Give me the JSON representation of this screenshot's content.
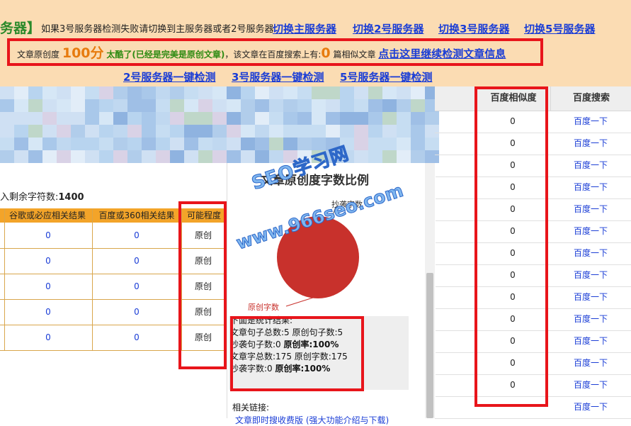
{
  "header": {
    "brand": "务器】",
    "hint": "如果3号服务器检测失败请切换到主服务器或者2号服务器",
    "links": [
      "切换主服务器",
      "切换2号服务器",
      "切换3号服务器",
      "切换5号服务器"
    ]
  },
  "originality": {
    "label": "文章原创度",
    "score": "100分",
    "verdict": "太酷了(已经是完美是原创文章)",
    "search_prefix": "，该文章在百度搜索上有:",
    "similar_count": "0",
    "similar_suffix": "篇相似文章",
    "continue_link": "点击这里继续检测文章信息"
  },
  "check_links": [
    "2号服务器一键检测",
    "3号服务器一键检测",
    "5号服务器一键检测"
  ],
  "right_table": {
    "headers": [
      "百度相似度",
      "百度搜索"
    ],
    "rows": [
      {
        "similarity": "0",
        "search": "百度一下"
      },
      {
        "similarity": "0",
        "search": "百度一下"
      },
      {
        "similarity": "0",
        "search": "百度一下"
      },
      {
        "similarity": "0",
        "search": "百度一下"
      },
      {
        "similarity": "0",
        "search": "百度一下"
      },
      {
        "similarity": "0",
        "search": "百度一下"
      },
      {
        "similarity": "0",
        "search": "百度一下"
      },
      {
        "similarity": "0",
        "search": "百度一下"
      },
      {
        "similarity": "0",
        "search": "百度一下"
      },
      {
        "similarity": "0",
        "search": "百度一下"
      },
      {
        "similarity": "0",
        "search": "百度一下"
      },
      {
        "similarity": "0",
        "search": "百度一下"
      },
      {
        "similarity": "0",
        "search": "百度一下"
      },
      {
        "similarity": "",
        "search": "百度一下"
      }
    ]
  },
  "left_table": {
    "remain_label": "入剩余字符数:",
    "remain_value": "1400",
    "headers": [
      "谷歌或必应相关结果",
      "百度或360相关结果",
      "可能程度"
    ],
    "rows": [
      {
        "google": "0",
        "baidu": "0",
        "level": "原创"
      },
      {
        "google": "0",
        "baidu": "0",
        "level": "原创"
      },
      {
        "google": "0",
        "baidu": "0",
        "level": "原创"
      },
      {
        "google": "0",
        "baidu": "0",
        "level": "原创"
      },
      {
        "google": "0",
        "baidu": "0",
        "level": "原创"
      }
    ]
  },
  "pie": {
    "title": "文章原创度字数比例",
    "label_copy": "抄袭字数",
    "label_orig": "原创字数",
    "color": "#c8312c"
  },
  "stats": {
    "intro": "下面是统计结果:",
    "line1": "文章句子总数:5 原创句子数:5",
    "line2_prefix": "抄袭句子数:0 ",
    "line2_bold": "原创率:100%",
    "line3": "文章字总数:175 原创字数:175",
    "line4_prefix": "抄袭字数:0 ",
    "line4_bold": "原创率:100%"
  },
  "related_label": "相关链接:",
  "related_link": "文章即时搜收费版 (强大功能介绍与下载)",
  "watermark_a": "SEO学习网",
  "watermark_b": "www.966seo.com",
  "chart_data": {
    "type": "pie",
    "title": "文章原创度字数比例",
    "labels": [
      "原创字数",
      "抄袭字数"
    ],
    "values": [
      175,
      0
    ]
  }
}
